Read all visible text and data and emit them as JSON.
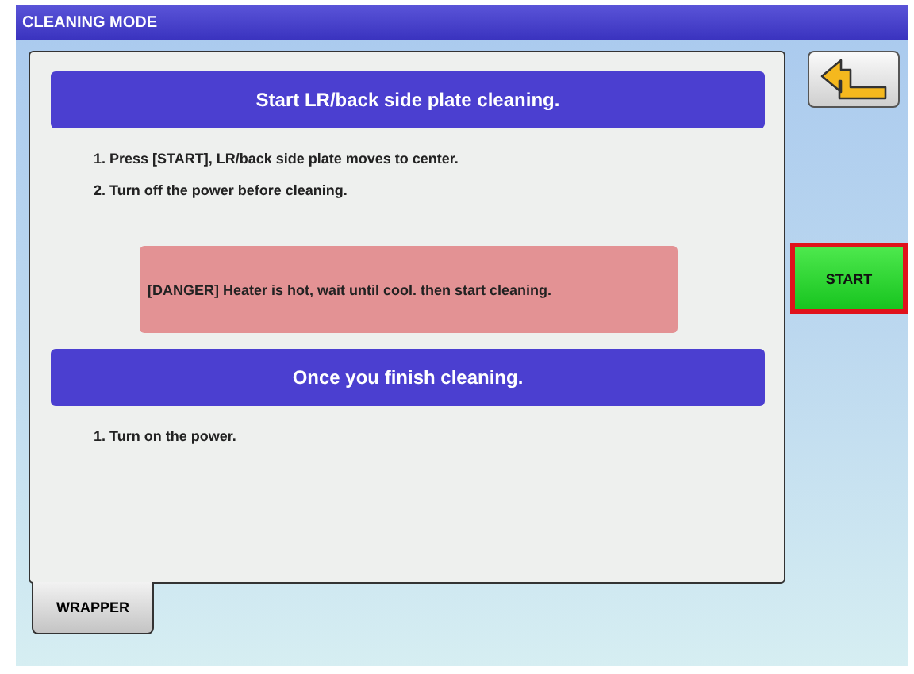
{
  "window": {
    "title": "CLEANING MODE"
  },
  "sections": [
    {
      "heading": "Start LR/back side plate cleaning.",
      "steps": [
        "1. Press [START], LR/back side plate moves to center.",
        "2. Turn off the power before cleaning."
      ],
      "warning": "[DANGER] Heater is hot, wait until cool. then start cleaning."
    },
    {
      "heading": "Once you finish cleaning.",
      "steps": [
        "1. Turn on the power."
      ]
    }
  ],
  "tabs": [
    {
      "label": "WRAPPER",
      "selected": true
    }
  ],
  "start_button": {
    "label": "START",
    "highlighted": true
  }
}
